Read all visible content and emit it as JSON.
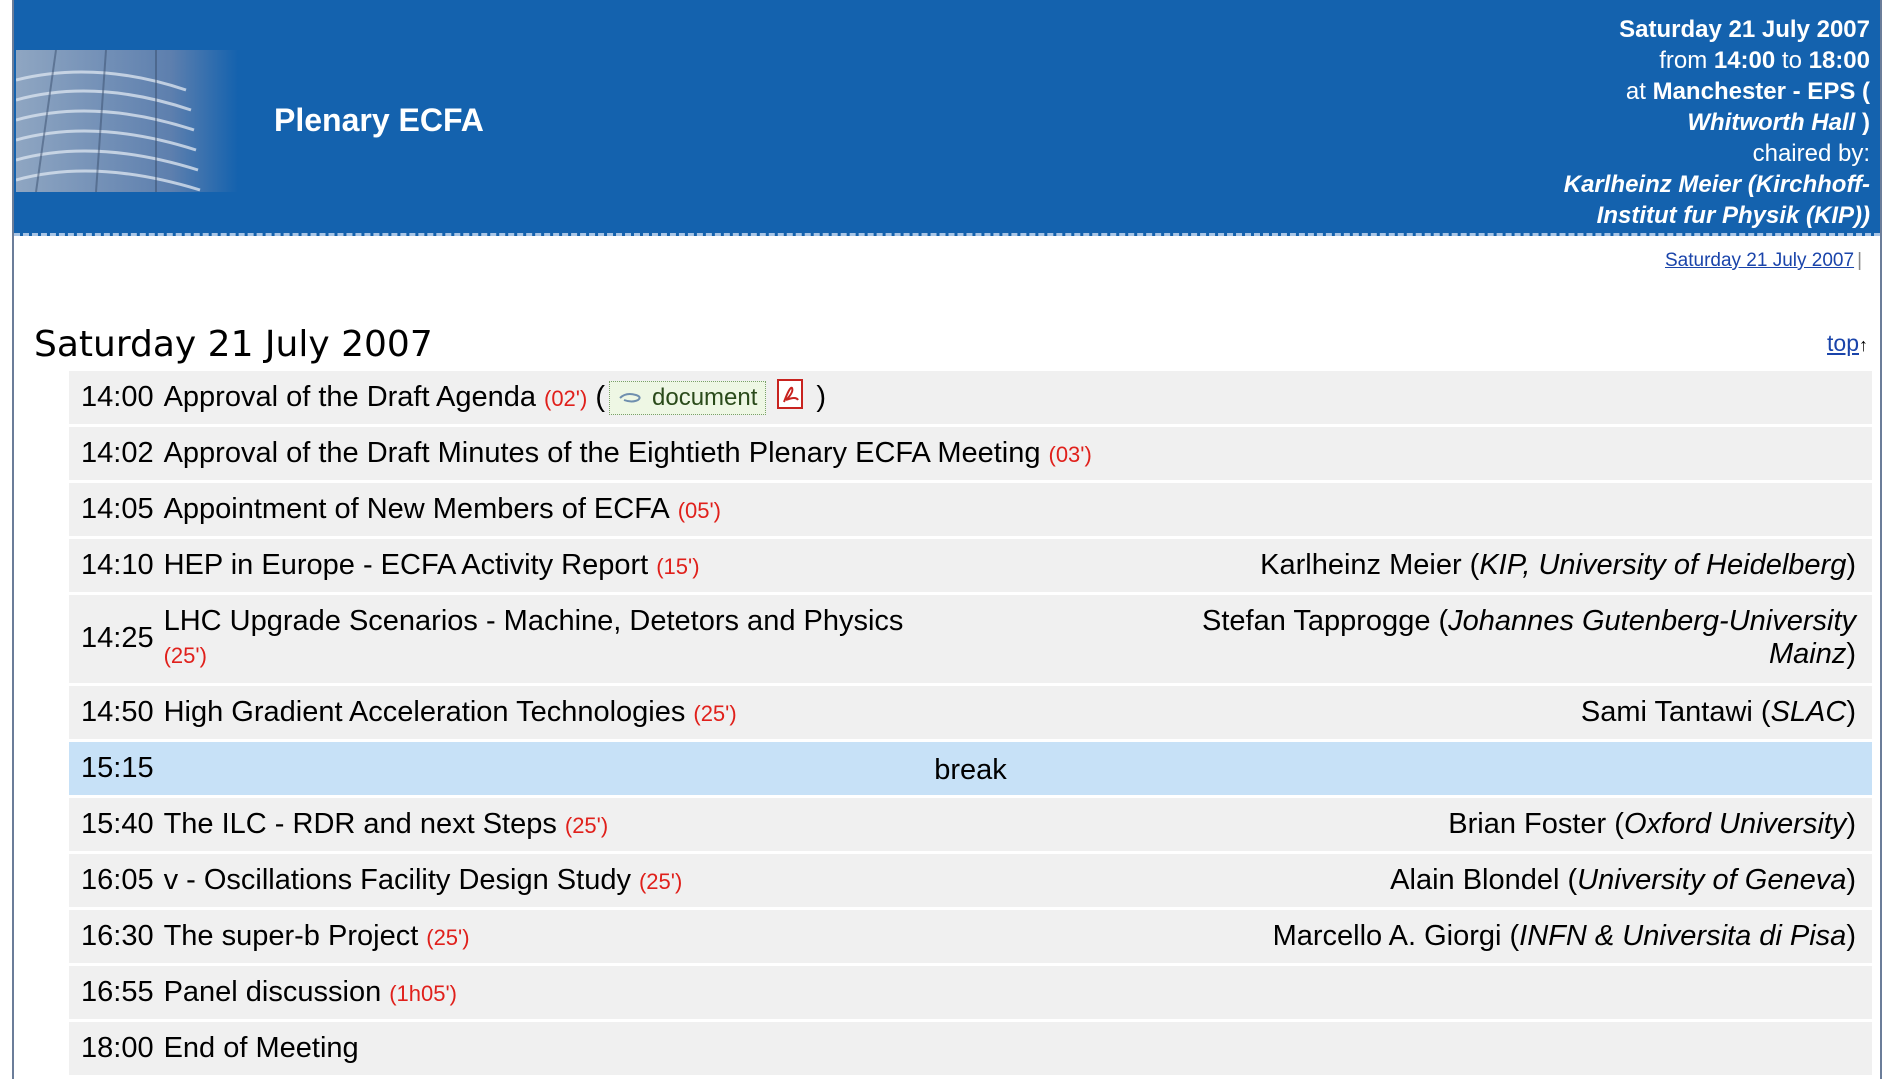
{
  "header": {
    "title": "Plenary ECFA",
    "date_line": "Saturday 21 July 2007",
    "from_prefix": "from ",
    "start": "14:00",
    "to_word": " to ",
    "end": "18:00",
    "at_prefix": "at ",
    "location": "Manchester - EPS (",
    "room": "Whitworth Hall",
    "room_close": " )",
    "chaired_by": "chaired by:",
    "chair_line1": "Karlheinz Meier (Kirchhoff-",
    "chair_line2": "Institut fur Physik (KIP))"
  },
  "nav": {
    "day_link": "Saturday 21 July 2007",
    "sep": "|"
  },
  "day": {
    "heading": "Saturday 21 July 2007",
    "top_link": "top",
    "top_arrow": "↑"
  },
  "doc_label": "document",
  "rows": [
    {
      "time": "14:00",
      "title": "Approval of the Draft Agenda",
      "duration": "(02')",
      "has_doc": true,
      "speaker": "",
      "affil": ""
    },
    {
      "time": "14:02",
      "title": "Approval of the Draft Minutes of the Eightieth Plenary ECFA Meeting",
      "duration": "(03')",
      "speaker": "",
      "affil": ""
    },
    {
      "time": "14:05",
      "title": "Appointment of New Members of ECFA",
      "duration": "(05')",
      "speaker": "",
      "affil": ""
    },
    {
      "time": "14:10",
      "title": "HEP in Europe - ECFA Activity Report",
      "duration": "(15')",
      "speaker": "Karlheinz Meier (",
      "affil": "KIP, University of Heidelberg",
      "close": ")"
    },
    {
      "time": "14:25",
      "title": "LHC Upgrade Scenarios - Machine, Detetors and Physics",
      "duration": "(25')",
      "speaker": "Stefan Tapprogge (",
      "affil": "Johannes Gutenberg-University",
      "affil2": "Mainz",
      "close": ")"
    },
    {
      "time": "14:50",
      "title": "High Gradient Acceleration Technologies",
      "duration": "(25')",
      "speaker": "Sami Tantawi (",
      "affil": "SLAC",
      "close": ")"
    },
    {
      "time": "15:15",
      "title": "break",
      "is_break": true
    },
    {
      "time": "15:40",
      "title": "The ILC - RDR and next Steps",
      "duration": "(25')",
      "speaker": "Brian Foster (",
      "affil": "Oxford University",
      "close": ")"
    },
    {
      "time": "16:05",
      "title": "v - Oscillations Facility Design Study",
      "duration": "(25')",
      "speaker": "Alain Blondel (",
      "affil": "University of Geneva",
      "close": ")"
    },
    {
      "time": "16:30",
      "title": "The super-b Project",
      "duration": "(25')",
      "speaker": "Marcello A. Giorgi (",
      "affil": "INFN & Universita di Pisa",
      "close": ")"
    },
    {
      "time": "16:55",
      "title": "Panel discussion",
      "duration": "(1h05')",
      "speaker": "",
      "affil": ""
    },
    {
      "time": "18:00",
      "title": "End of Meeting",
      "duration": "",
      "speaker": "",
      "affil": ""
    }
  ]
}
